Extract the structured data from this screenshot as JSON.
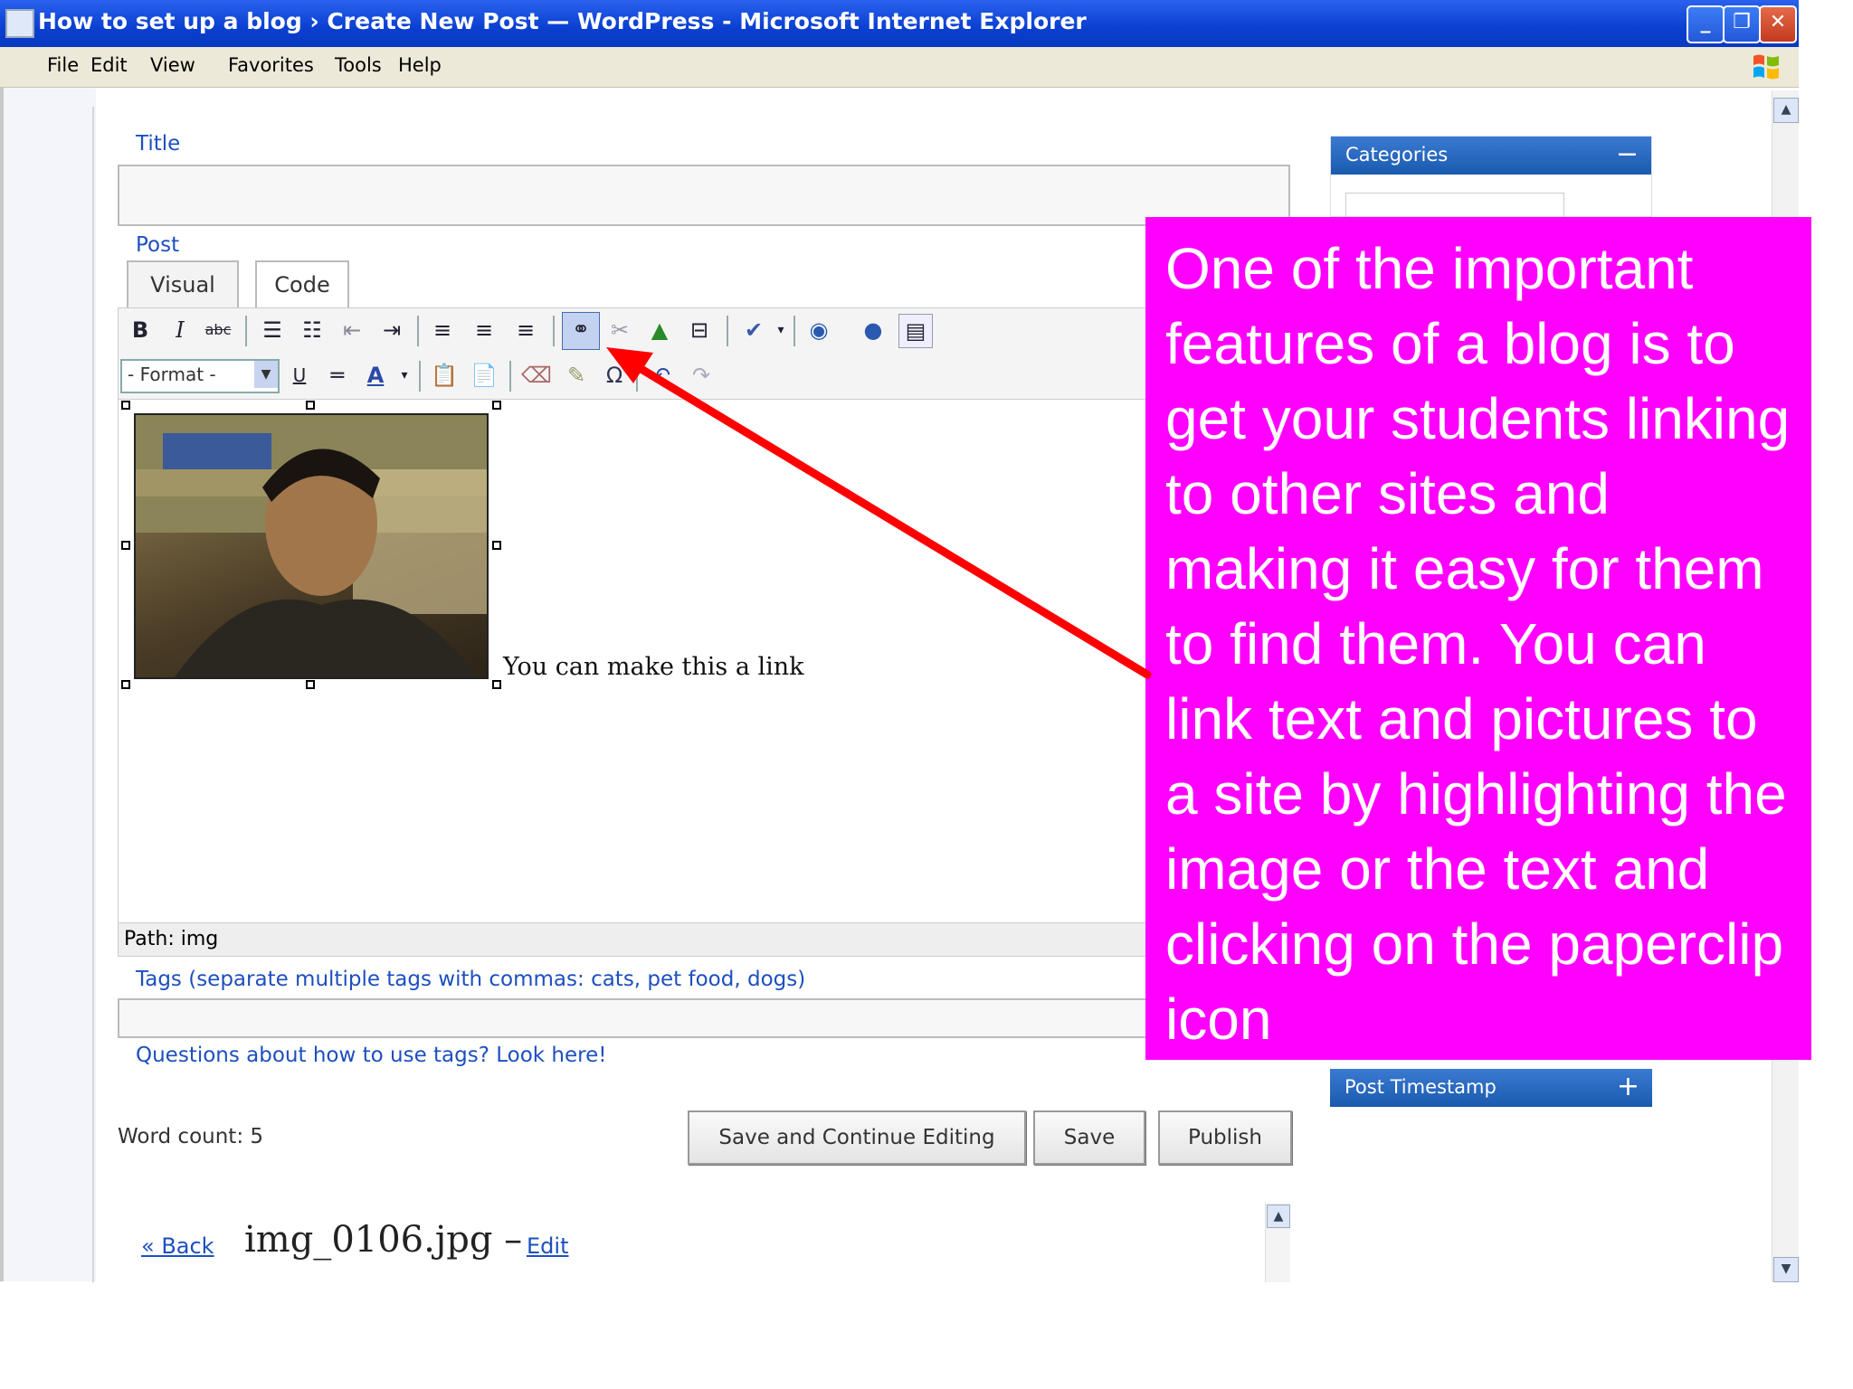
{
  "window": {
    "title": "How to set up a blog › Create New Post — WordPress - Microsoft Internet Explorer",
    "minimize": "_",
    "maximize": "❐",
    "close": "✕"
  },
  "menu": [
    "File",
    "Edit",
    "View",
    "Favorites",
    "Tools",
    "Help"
  ],
  "post": {
    "title_label": "Title",
    "post_label": "Post",
    "tab_visual": "Visual",
    "tab_code": "Code",
    "format_select": "- Format -",
    "caption_text": "You can make this a link",
    "path_text": "Path: img",
    "tags_label": "Tags (separate multiple tags with commas: cats, pet food, dogs)",
    "tags_help": "Questions about how to use tags? Look here!",
    "word_count": "Word count: 5",
    "btn_save_continue": "Save and Continue Editing",
    "btn_save": "Save",
    "btn_publish": "Publish"
  },
  "sidebar": {
    "categories": "Categories",
    "categories_toggle": "−",
    "timestamp": "Post Timestamp",
    "timestamp_toggle": "+"
  },
  "attachment": {
    "back": "« Back",
    "filename": "img_0106.jpg –",
    "edit": "Edit"
  },
  "callout": {
    "text": "One of the important features of a blog is to get your students linking to other sites and making it easy for them to find them. You can link text and pictures to a site by highlighting the image or the text and clicking on the paperclip icon"
  },
  "toolbar": {
    "bold": "B",
    "italic": "I",
    "strike": "abc",
    "underline": "U",
    "hr": "═",
    "color": "A"
  },
  "colors": {
    "callout_bg": "#ff00ff",
    "arrow": "#ff0000",
    "titlebar": "#0a3fd0",
    "panel_header": "#1a5aae"
  }
}
